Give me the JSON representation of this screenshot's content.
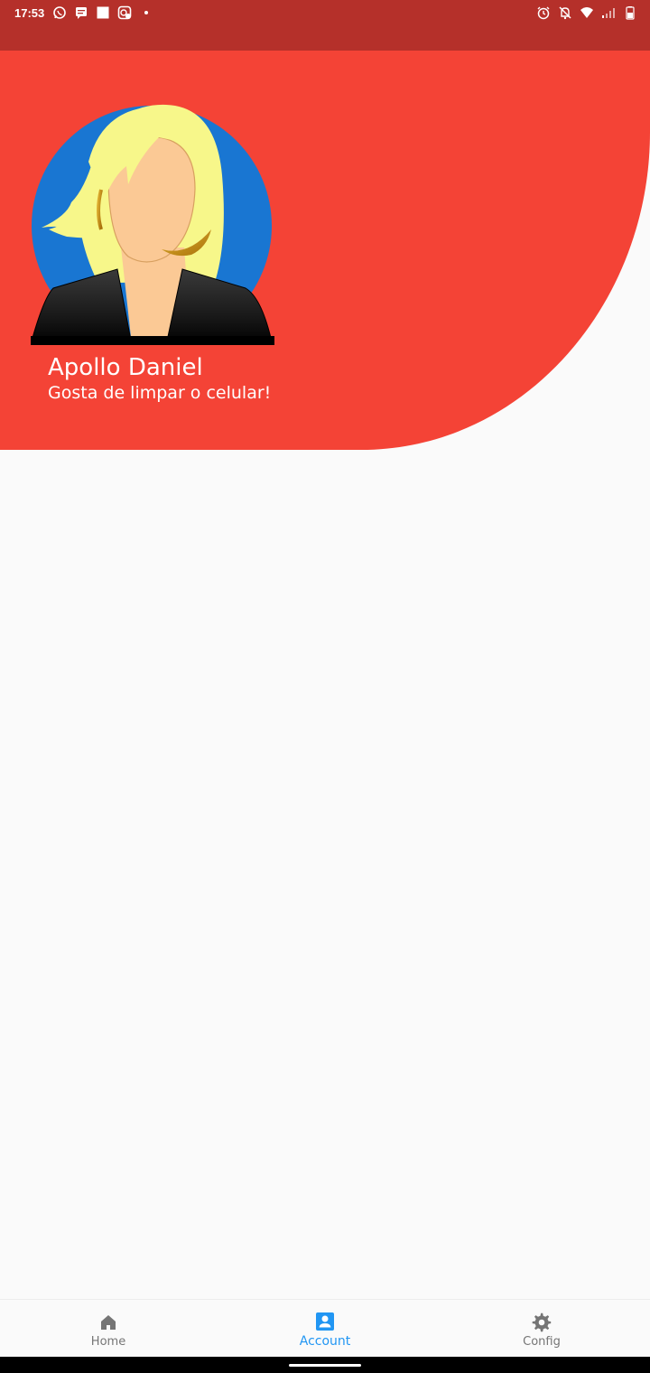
{
  "status_bar": {
    "time": "17:53",
    "left_icons": [
      "whatsapp-icon",
      "message-icon",
      "square-notification-icon",
      "app-notification-icon",
      "more-dot-icon"
    ],
    "right_icons": [
      "alarm-icon",
      "silent-bell-icon",
      "wifi-icon",
      "signal-icon",
      "battery-icon"
    ],
    "background": "#b5302a"
  },
  "profile": {
    "name": "Apollo Daniel",
    "bio": "Gosta de limpar o celular!",
    "header_color": "#f44336",
    "avatar_bg": "#1976d2"
  },
  "bottom_nav": {
    "items": [
      {
        "label": "Home",
        "icon": "home-icon",
        "active": false
      },
      {
        "label": "Account",
        "icon": "account-box-icon",
        "active": true
      },
      {
        "label": "Config",
        "icon": "gear-icon",
        "active": false
      }
    ],
    "active_color": "#2196f3",
    "inactive_color": "#757575"
  }
}
